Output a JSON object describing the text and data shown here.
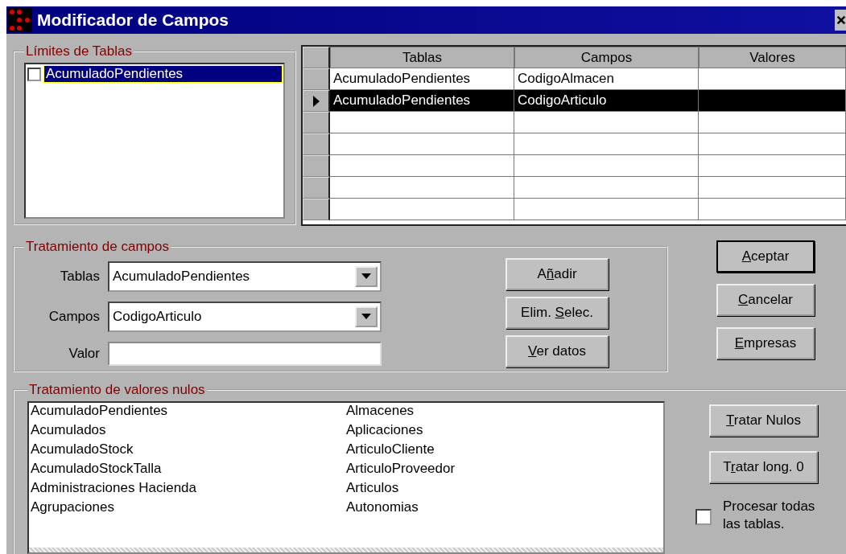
{
  "window": {
    "title": "Modificador de Campos"
  },
  "limits": {
    "title": "Límites de Tablas",
    "items": [
      {
        "label": "AcumuladoPendientes",
        "checked": false,
        "selected": true
      }
    ]
  },
  "grid": {
    "columns": [
      "Tablas",
      "Campos",
      "Valores"
    ],
    "rows": [
      {
        "cells": [
          "AcumuladoPendientes",
          "CodigoAlmacen"
        ],
        "selected": false
      },
      {
        "cells": [
          "AcumuladoPendientes",
          "CodigoArticulo"
        ],
        "selected": true
      },
      {
        "selected": false
      },
      {
        "selected": false
      },
      {
        "selected": false
      },
      {
        "selected": false
      },
      {
        "selected": false
      }
    ]
  },
  "fields": {
    "title": "Tratamiento de campos",
    "rows": [
      {
        "label": "Tablas",
        "kind": "dropdown",
        "value": "AcumuladoPendientes"
      },
      {
        "label": "Campos",
        "kind": "dropdown",
        "value": "CodigoArticulo"
      },
      {
        "label": "Valor",
        "kind": "text"
      }
    ],
    "buttons": [
      {
        "pre": "A",
        "key": "ñ",
        "post": "adir"
      },
      {
        "pre": "Elim. ",
        "key": "S",
        "post": "elec."
      },
      {
        "key": "V",
        "post": "er datos"
      }
    ]
  },
  "dialog_buttons": [
    {
      "key": "A",
      "post": "ceptar",
      "default": true
    },
    {
      "key": "C",
      "post": "ancelar",
      "default": false
    },
    {
      "key": "E",
      "post": "mpresas",
      "default": false
    }
  ],
  "nulls": {
    "title": "Tratamiento de valores nulos",
    "tables": [
      "AcumuladoPendientes",
      "Acumulados",
      "AcumuladoStock",
      "AcumuladoStockTalla",
      "Administraciones Hacienda",
      "Agrupaciones",
      "Almacenes",
      "Aplicaciones",
      "ArticuloCliente",
      "ArticuloProveedor",
      "Articulos",
      "Autonomias"
    ],
    "buttons": [
      {
        "key": "T",
        "post": "ratar Nulos"
      },
      {
        "pre": "T",
        "key": "r",
        "post": "atar long. 0"
      }
    ],
    "process_all": {
      "label": "Procesar todas las tablas.",
      "checked": false
    }
  }
}
